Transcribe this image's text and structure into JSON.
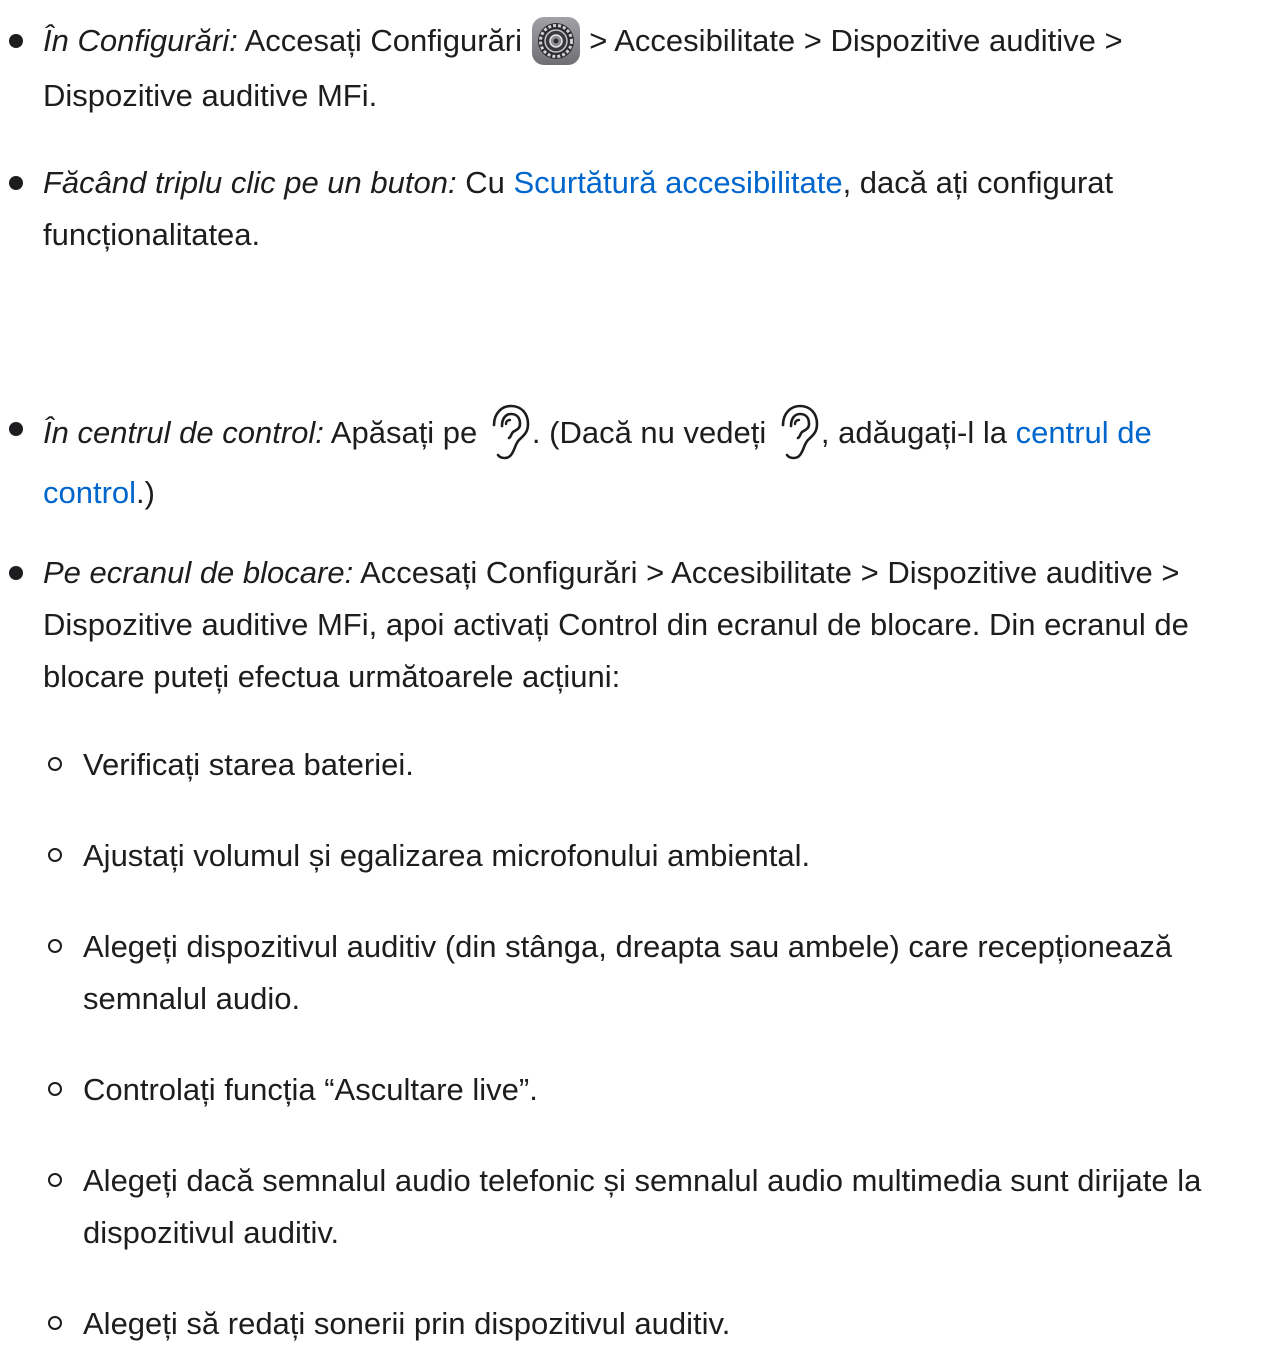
{
  "methods": [
    {
      "label": "În Configurări:",
      "text_before_icon": " Accesați Configurări ",
      "icon": "settings-gear-icon",
      "text_after_icon": " > Accesibilitate > Dispozitive auditive > Dispozitive auditive MFi."
    },
    {
      "label": "Făcând triplu clic pe un buton:",
      "text_before_link": " Cu ",
      "link": "Scurtătură accesibilitate",
      "text_after_link": ", dacă ați configurat funcționalitatea."
    },
    {
      "label": "În centrul de control:",
      "text_before_icon": " Apăsați pe ",
      "icon": "hearing-ear-icon",
      "text_middle": ". (Dacă nu vedeți ",
      "text_after_icon": ", adăugați-l la ",
      "link": "centrul de control",
      "text_end": ".)"
    },
    {
      "label": "Pe ecranul de blocare:",
      "text": " Accesați Configurări > Accesibilitate > Dispozitive auditive > Dispozitive auditive MFi, apoi activați Control din ecranul de blocare. Din ecranul de blocare puteți efectua următoarele acțiuni:"
    }
  ],
  "lock_screen_actions": [
    "Verificați starea bateriei.",
    "Ajustați volumul și egalizarea microfonului ambiental.",
    "Alegeți dispozitivul auditiv (din stânga, dreapta sau ambele) care recepționează semnalul audio.",
    "Controlați funcția “Ascultare live”.",
    "Alegeți dacă semnalul audio telefonic și semnalul audio multimedia sunt dirijate la dispozitivul auditiv.",
    "Alegeți să redați sonerii prin dispozitivul auditiv."
  ],
  "colors": {
    "text": "#1d1d1f",
    "link": "#0066cc",
    "settings_icon_bg": "#8e8e93"
  }
}
